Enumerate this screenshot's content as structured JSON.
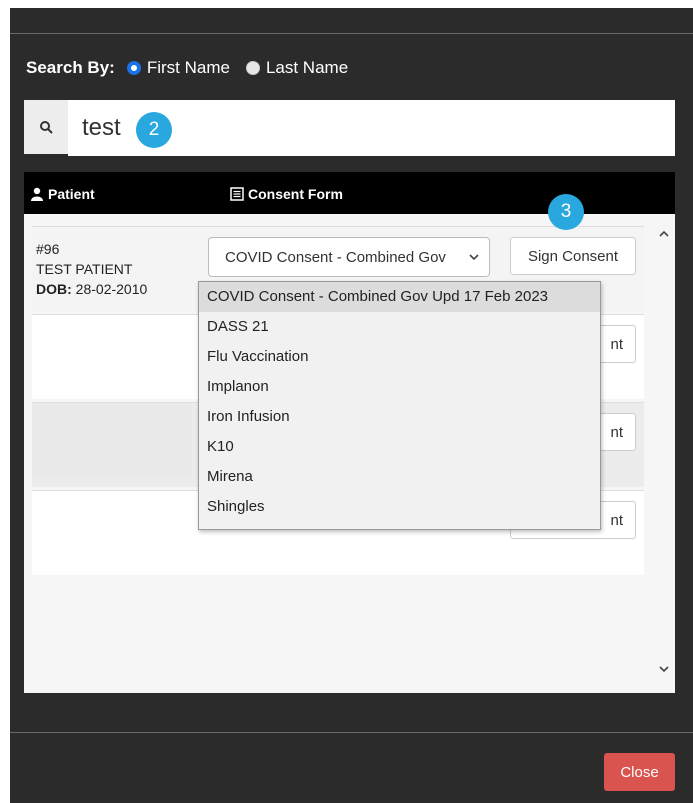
{
  "search": {
    "label": "Search By:",
    "option_first": "First Name",
    "option_last": "Last Name",
    "query": "test"
  },
  "badges": {
    "two": "2",
    "three": "3"
  },
  "table": {
    "col_patient": "Patient",
    "col_consent": "Consent Form"
  },
  "row1": {
    "id": "#96",
    "name": "TEST PATIENT",
    "dob_label": "DOB:",
    "dob": "28-02-2010",
    "selected_form": "COVID Consent - Combined Gov",
    "sign_label": "Sign Consent"
  },
  "partial_button_text": "nt",
  "dropdown_options": [
    "COVID Consent - Combined Gov Upd 17 Feb 2023",
    "DASS 21",
    "Flu Vaccination",
    "Implanon",
    "Iron Infusion",
    "K10",
    "Mirena",
    "Shingles"
  ],
  "footer": {
    "close_label": "Close"
  },
  "colors": {
    "accent": "#1a73e8",
    "badge": "#29a8e0",
    "danger": "#d9534f"
  }
}
